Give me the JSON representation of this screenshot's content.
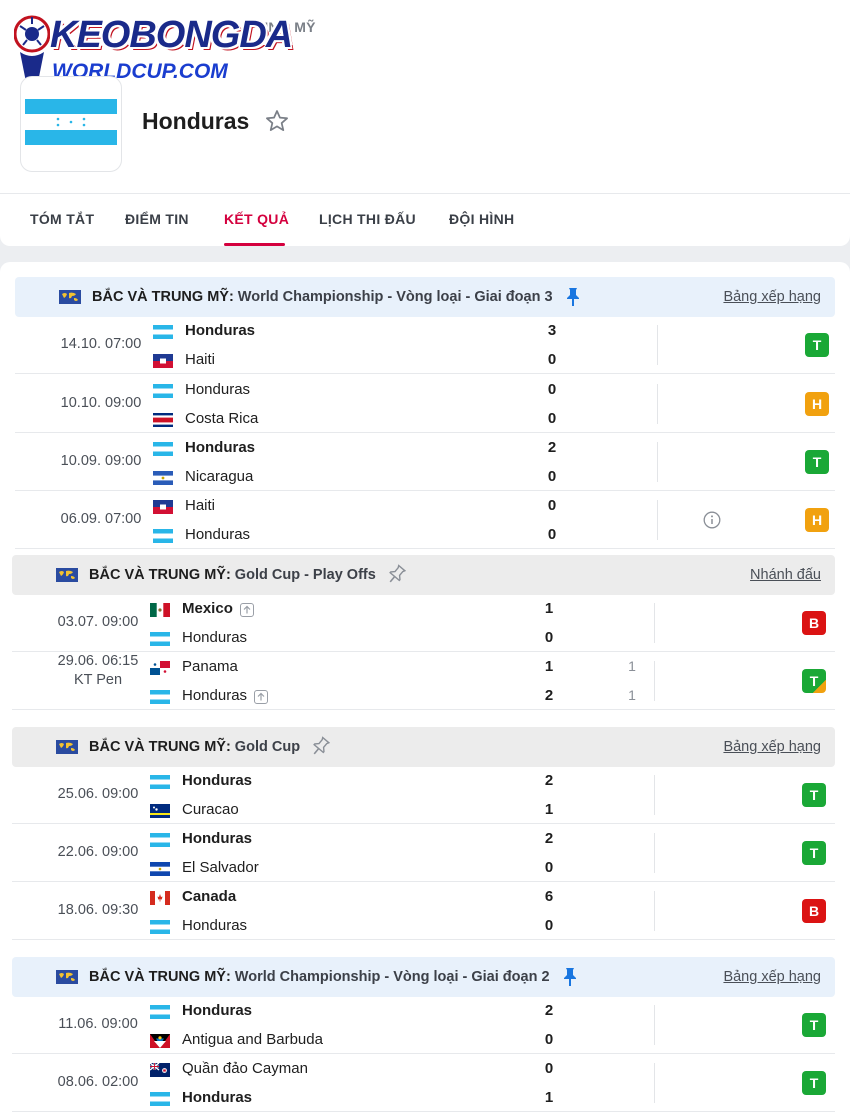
{
  "header": {
    "logo_main": "KEOBONGDA",
    "logo_sub": "WORLDCUP.COM",
    "breadcrumb": "UNG MỸ",
    "team_name": "Honduras",
    "favorite_icon": "star-outline-icon"
  },
  "tabs": [
    {
      "label": "TÓM TẮT",
      "active": false
    },
    {
      "label": "ĐIỂM TIN",
      "active": false
    },
    {
      "label": "KẾT QUẢ",
      "active": true
    },
    {
      "label": "LỊCH THI ĐẤU",
      "active": false
    },
    {
      "label": "ĐỘI HÌNH",
      "active": false
    }
  ],
  "colors": {
    "accent": "#d4003e",
    "win": "#1aa836",
    "draw": "#f1a10f",
    "loss": "#db1313",
    "pinned_header_bg": "#e8f1fb",
    "header_bg": "#ececec"
  },
  "groups": [
    {
      "region": "BẮC VÀ TRUNG MỸ:",
      "competition": "World Championship - Vòng loại - Giai đoạn 3",
      "pinned": true,
      "link": "Bảng xếp hạng",
      "matches": [
        {
          "time": "14.10. 07:00",
          "home": "Honduras",
          "home_flag": "honduras",
          "away": "Haiti",
          "away_flag": "haiti",
          "home_score": "3",
          "away_score": "0",
          "home_win": true,
          "away_win": false,
          "result": "T"
        },
        {
          "time": "10.10. 09:00",
          "home": "Honduras",
          "home_flag": "honduras",
          "away": "Costa Rica",
          "away_flag": "costa-rica",
          "home_score": "0",
          "away_score": "0",
          "home_win": false,
          "away_win": false,
          "result": "H"
        },
        {
          "time": "10.09. 09:00",
          "home": "Honduras",
          "home_flag": "honduras",
          "away": "Nicaragua",
          "away_flag": "nicaragua",
          "home_score": "2",
          "away_score": "0",
          "home_win": true,
          "away_win": false,
          "result": "T"
        },
        {
          "time": "06.09. 07:00",
          "home": "Haiti",
          "home_flag": "haiti",
          "away": "Honduras",
          "away_flag": "honduras",
          "home_score": "0",
          "away_score": "0",
          "home_win": false,
          "away_win": false,
          "result": "H",
          "info": true
        }
      ]
    },
    {
      "region": "BẮC VÀ TRUNG MỸ:",
      "competition": "Gold Cup - Play Offs",
      "pinned": false,
      "link": "Nhánh đấu",
      "matches": [
        {
          "time": "03.07. 09:00",
          "home": "Mexico",
          "home_flag": "mexico",
          "away": "Honduras",
          "away_flag": "honduras",
          "home_score": "1",
          "away_score": "0",
          "home_win": true,
          "away_win": false,
          "home_up": true,
          "result": "B"
        },
        {
          "time": "29.06. 06:15",
          "time2": "KT Pen",
          "home": "Panama",
          "home_flag": "panama",
          "away": "Honduras",
          "away_flag": "honduras",
          "home_score": "1",
          "away_score": "2",
          "home_pen": "1",
          "away_pen": "1",
          "home_win": false,
          "away_win": false,
          "away_up": true,
          "result": "T",
          "result_style": "corner"
        }
      ]
    },
    {
      "region": "BẮC VÀ TRUNG MỸ:",
      "competition": "Gold Cup",
      "pinned": false,
      "link": "Bảng xếp hạng",
      "matches": [
        {
          "time": "25.06. 09:00",
          "home": "Honduras",
          "home_flag": "honduras",
          "away": "Curacao",
          "away_flag": "curacao",
          "home_score": "2",
          "away_score": "1",
          "home_win": true,
          "away_win": false,
          "result": "T"
        },
        {
          "time": "22.06. 09:00",
          "home": "Honduras",
          "home_flag": "honduras",
          "away": "El Salvador",
          "away_flag": "el-salvador",
          "home_score": "2",
          "away_score": "0",
          "home_win": true,
          "away_win": false,
          "result": "T"
        },
        {
          "time": "18.06. 09:30",
          "home": "Canada",
          "home_flag": "canada",
          "away": "Honduras",
          "away_flag": "honduras",
          "home_score": "6",
          "away_score": "0",
          "home_win": true,
          "away_win": false,
          "result": "B"
        }
      ]
    },
    {
      "region": "BẮC VÀ TRUNG MỸ:",
      "competition": "World Championship - Vòng loại - Giai đoạn 2",
      "pinned": true,
      "link": "Bảng xếp hạng",
      "matches": [
        {
          "time": "11.06. 09:00",
          "home": "Honduras",
          "home_flag": "honduras",
          "away": "Antigua and Barbuda",
          "away_flag": "antigua",
          "home_score": "2",
          "away_score": "0",
          "home_win": true,
          "away_win": false,
          "result": "T"
        },
        {
          "time": "08.06. 02:00",
          "home": "Quần đảo Cayman",
          "home_flag": "cayman",
          "away": "Honduras",
          "away_flag": "honduras",
          "home_score": "0",
          "away_score": "1",
          "home_win": false,
          "away_win": true,
          "result": "T"
        }
      ]
    }
  ]
}
